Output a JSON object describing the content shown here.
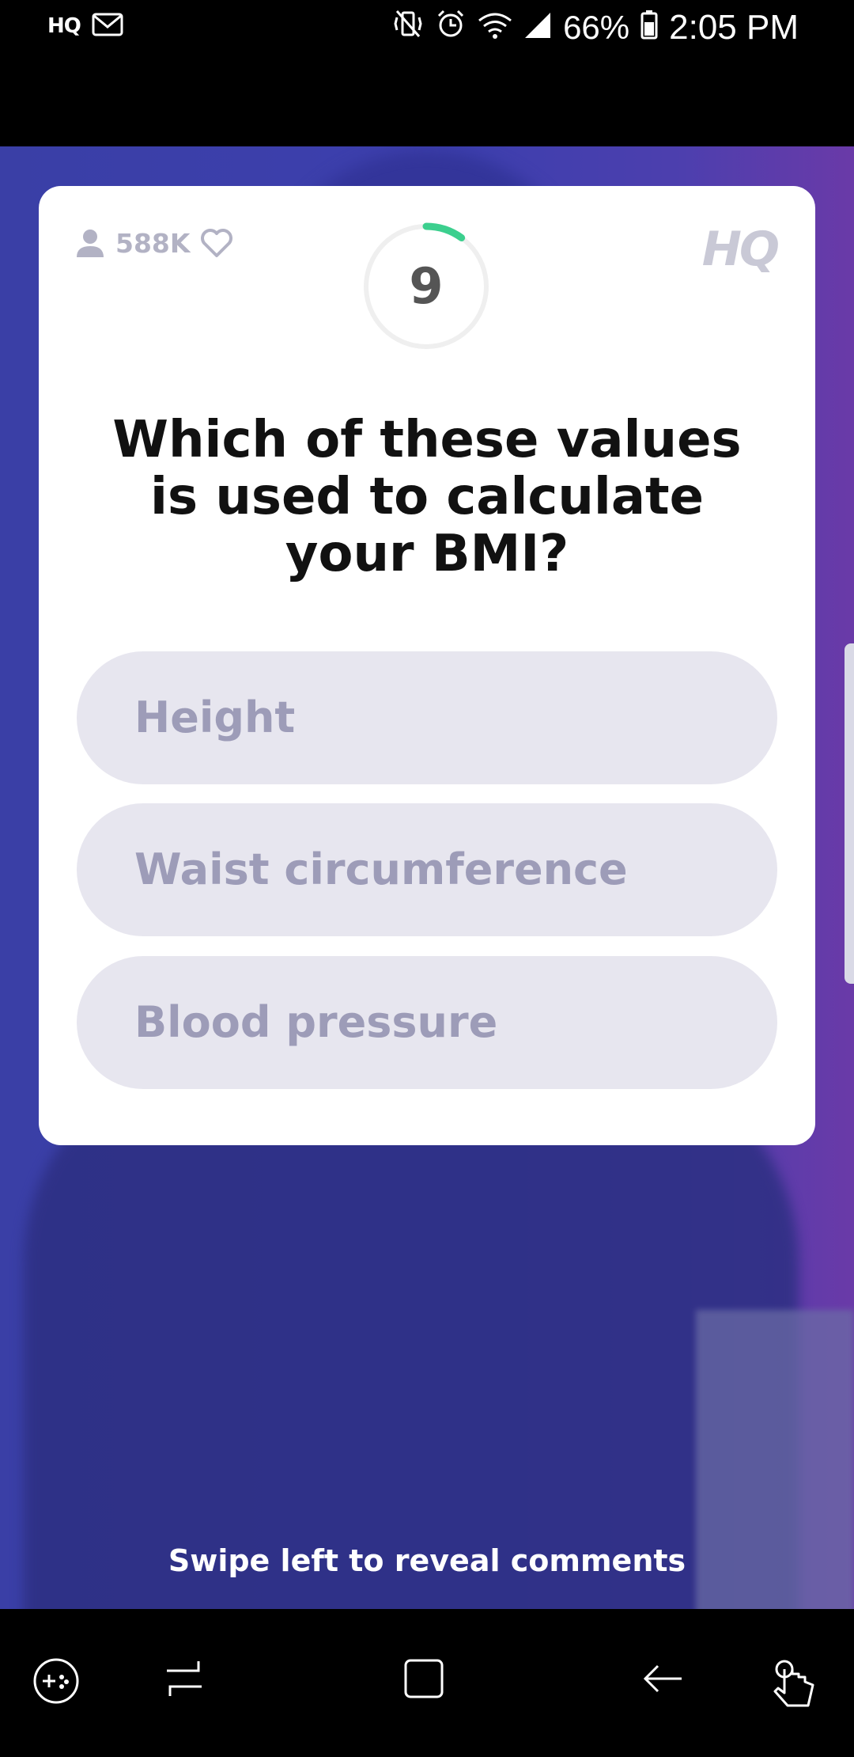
{
  "status_bar": {
    "left_app": "HQ",
    "battery": "66%",
    "time": "2:05 PM"
  },
  "game": {
    "player_count": "588K",
    "logo": "HQ",
    "timer": "9",
    "timer_progress": 0.1,
    "question": "Which of these values is used to calculate your BMI?",
    "answers": [
      "Height",
      "Waist circumference",
      "Blood pressure"
    ],
    "swipe_hint": "Swipe left to reveal comments"
  },
  "colors": {
    "accent_green": "#3ccf8e",
    "background_blue": "#3a3fa6",
    "answer_fill": "#e7e6ef",
    "answer_text": "#9d9cb8"
  }
}
